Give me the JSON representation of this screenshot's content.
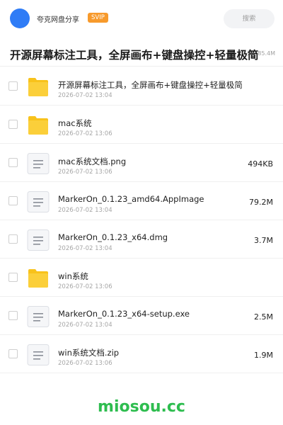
{
  "header": {
    "brand": "夸克网盘分享",
    "badge": "SVIP",
    "search_placeholder": "搜索"
  },
  "folder": {
    "title": "开源屏幕标注工具，全屏画布+键盘操控+轻量极简",
    "meta": "景 · 85.4M"
  },
  "files": [
    {
      "icon": "folder-icon",
      "name": "开源屏幕标注工具，全屏画布+键盘操控+轻量极简",
      "date": "2026-07-02 13:04",
      "size": ""
    },
    {
      "icon": "folder-icon",
      "name": "mac系统",
      "date": "2026-07-02 13:06",
      "size": ""
    },
    {
      "icon": "document-icon",
      "name": "mac系统文档.png",
      "date": "2026-07-02 13:06",
      "size": "494KB"
    },
    {
      "icon": "document-icon",
      "name": "MarkerOn_0.1.23_amd64.AppImage",
      "date": "2026-07-02 13:04",
      "size": "79.2M"
    },
    {
      "icon": "document-icon",
      "name": "MarkerOn_0.1.23_x64.dmg",
      "date": "2026-07-02 13:04",
      "size": "3.7M"
    },
    {
      "icon": "folder-icon",
      "name": "win系统",
      "date": "2026-07-02 13:06",
      "size": ""
    },
    {
      "icon": "document-icon",
      "name": "MarkerOn_0.1.23_x64-setup.exe",
      "date": "2026-07-02 13:04",
      "size": "2.5M"
    },
    {
      "icon": "document-icon",
      "name": "win系统文档.zip",
      "date": "2026-07-02 13:06",
      "size": "1.9M"
    }
  ],
  "watermark": "miosou.cc",
  "colors": {
    "accent_blue": "#2f7cf6",
    "svip_orange": "#f79a2c",
    "folder_yellow": "#f8c21b",
    "watermark_green": "#2ebd4f"
  }
}
